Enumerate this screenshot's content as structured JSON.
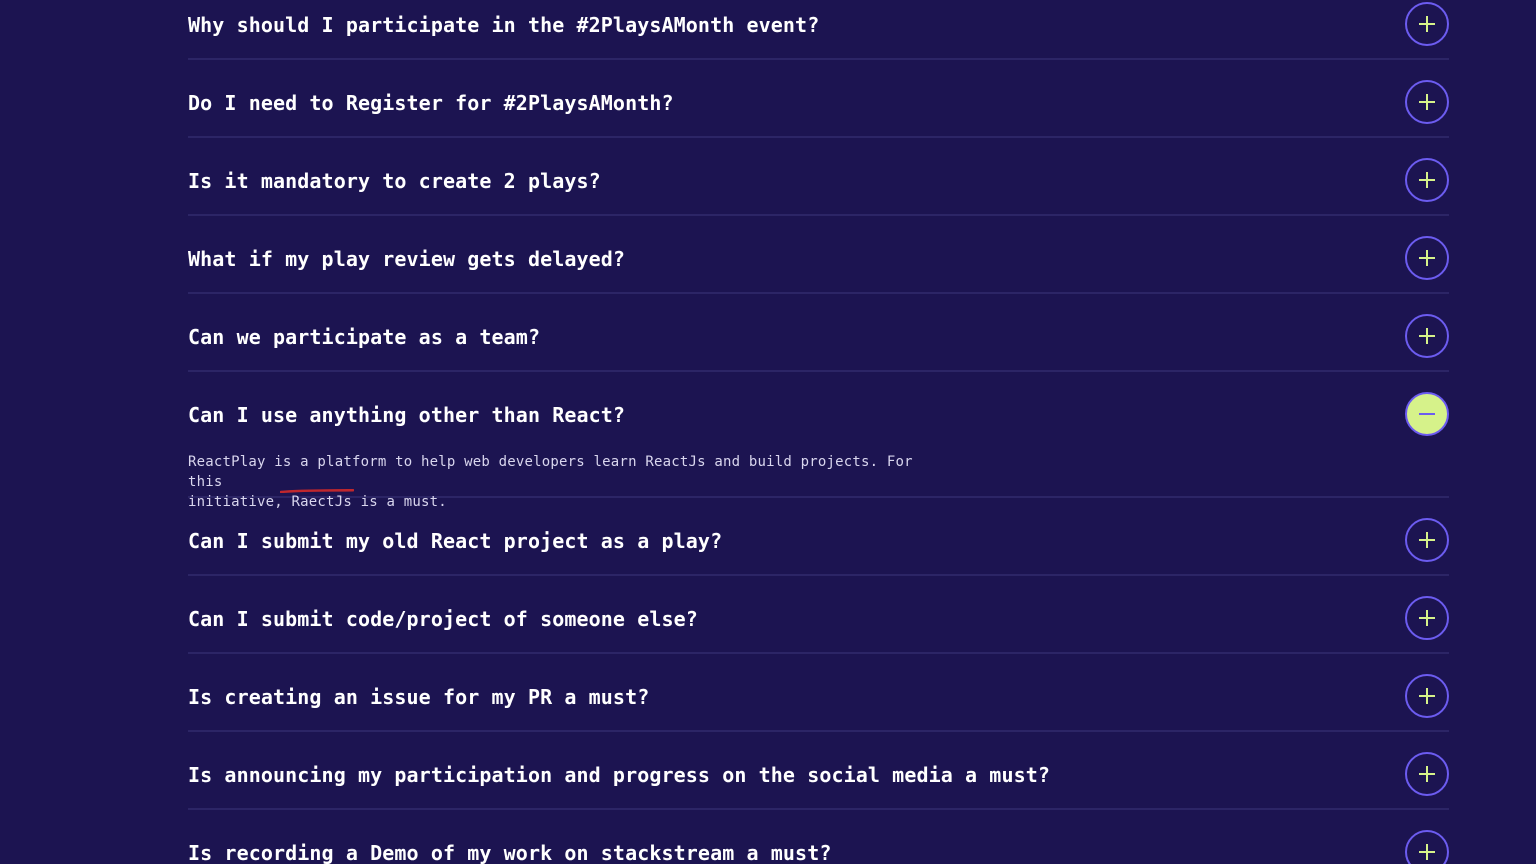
{
  "colors": {
    "background": "#1c1451",
    "divider": "#2c2566",
    "toggle_border": "#6c5cf0",
    "toggle_icon": "#d6f28a",
    "toggle_open_bg": "#d6f28a",
    "annotation_red": "#c0272d"
  },
  "faq": {
    "items": [
      {
        "question": "Why should I participate in the #2PlaysAMonth event?",
        "icon": "plus-icon"
      },
      {
        "question": "Do I need to Register for #2PlaysAMonth?",
        "icon": "plus-icon"
      },
      {
        "question": "Is it mandatory to create 2 plays?",
        "icon": "plus-icon"
      },
      {
        "question": "What if my play review gets delayed?",
        "icon": "plus-icon"
      },
      {
        "question": "Can we participate as a team?",
        "icon": "plus-icon"
      },
      {
        "question": "Can I use anything other than React?",
        "icon": "minus-icon",
        "expanded": true,
        "answer_line1": "ReactPlay is a platform to help web developers learn ReactJs and build projects. For this",
        "answer_line2": "initiative, RaectJs is a must."
      },
      {
        "question": "Can I submit my old React project as a play?",
        "icon": "plus-icon"
      },
      {
        "question": "Can I submit code/project of someone else?",
        "icon": "plus-icon"
      },
      {
        "question": "Is creating an issue for my PR a must?",
        "icon": "plus-icon"
      },
      {
        "question": "Is announcing my participation and progress on the social media a must?",
        "icon": "plus-icon"
      },
      {
        "question": "Is recording a Demo of my work on stackstream a must?",
        "icon": "plus-icon"
      }
    ]
  }
}
